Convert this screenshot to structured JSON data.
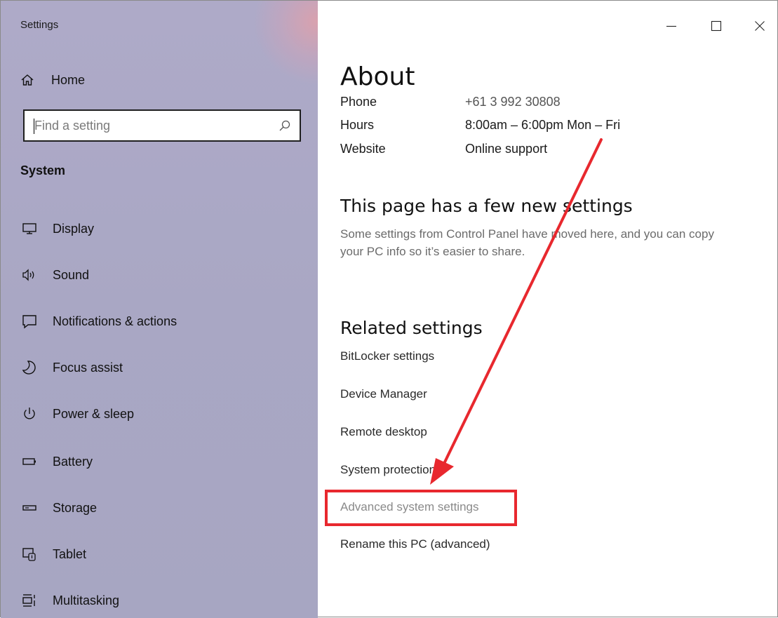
{
  "window": {
    "title": "Settings",
    "controls": {
      "minimize": "minimize",
      "maximize": "maximize",
      "close": "close"
    }
  },
  "sidebar": {
    "home_label": "Home",
    "search": {
      "placeholder": "Find a setting",
      "value": ""
    },
    "section_title": "System",
    "items": [
      {
        "label": "Display",
        "icon": "display-icon"
      },
      {
        "label": "Sound",
        "icon": "speaker-icon"
      },
      {
        "label": "Notifications & actions",
        "icon": "notification-icon"
      },
      {
        "label": "Focus assist",
        "icon": "moon-icon"
      },
      {
        "label": "Power & sleep",
        "icon": "power-icon"
      },
      {
        "label": "Battery",
        "icon": "battery-icon"
      },
      {
        "label": "Storage",
        "icon": "storage-icon"
      },
      {
        "label": "Tablet",
        "icon": "tablet-icon"
      },
      {
        "label": "Multitasking",
        "icon": "multitasking-icon"
      }
    ]
  },
  "main": {
    "title": "About",
    "support": {
      "phone": {
        "label": "Phone",
        "value": "+61 3 992 30808"
      },
      "hours": {
        "label": "Hours",
        "value": "8:00am – 6:00pm Mon – Fri"
      },
      "website": {
        "label": "Website",
        "value": "Online support"
      }
    },
    "new_settings": {
      "heading": "This page has a few new settings",
      "description": "Some settings from Control Panel have moved here, and you can copy your PC info so it’s easier to share."
    },
    "related": {
      "heading": "Related settings",
      "links": [
        "BitLocker settings",
        "Device Manager",
        "Remote desktop",
        "System protection",
        "Advanced system settings",
        "Rename this PC (advanced)"
      ]
    }
  },
  "annotation": {
    "color": "#e8282e"
  }
}
